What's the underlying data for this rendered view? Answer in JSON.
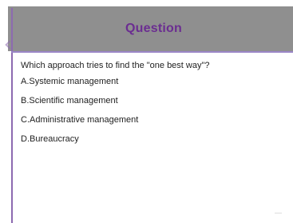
{
  "slide": {
    "title": "Question",
    "question": "Which approach tries to find the \"one best way\"?",
    "options": [
      "A.Systemic management",
      "B.Scientific management",
      "C.Administrative management",
      "D.Bureaucracy"
    ],
    "footer_mark": "—"
  },
  "colors": {
    "header_band": "#8f8f8f",
    "title_text": "#6b2d91",
    "accent_rule": "#8d6ab0",
    "divider": "#9b86c7"
  }
}
